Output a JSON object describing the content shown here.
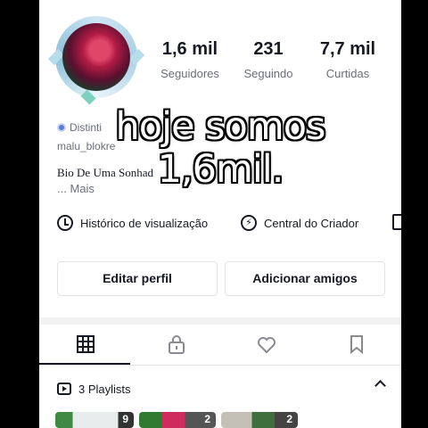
{
  "profile": {
    "followers": {
      "value": "1,6 mil",
      "label": "Seguidores"
    },
    "following": {
      "value": "231",
      "label": "Seguindo"
    },
    "likes": {
      "value": "7,7 mil",
      "label": "Curtidas"
    },
    "badge_text": "Distinti",
    "username": "malu_blokre",
    "bio": "Bio De Uma Sonhad",
    "more": "... Mais"
  },
  "caption": {
    "line1": "hoje somos",
    "line2": "1,6mil."
  },
  "links": {
    "history": "Histórico de visualização",
    "creator": "Central do Criador"
  },
  "buttons": {
    "edit": "Editar perfil",
    "add_friends": "Adicionar amigos"
  },
  "playlists": {
    "label": "3 Playlists",
    "counts": [
      "9",
      "2",
      "2"
    ]
  },
  "icons": {
    "history": "clock-icon",
    "creator": "bolt-icon",
    "shop": "bag-icon",
    "videos": "grid-icon",
    "private": "lock-icon",
    "liked": "heart-icon",
    "saved": "bookmark-icon",
    "playlist": "playlist-icon",
    "collapse": "chevron-up-icon"
  }
}
